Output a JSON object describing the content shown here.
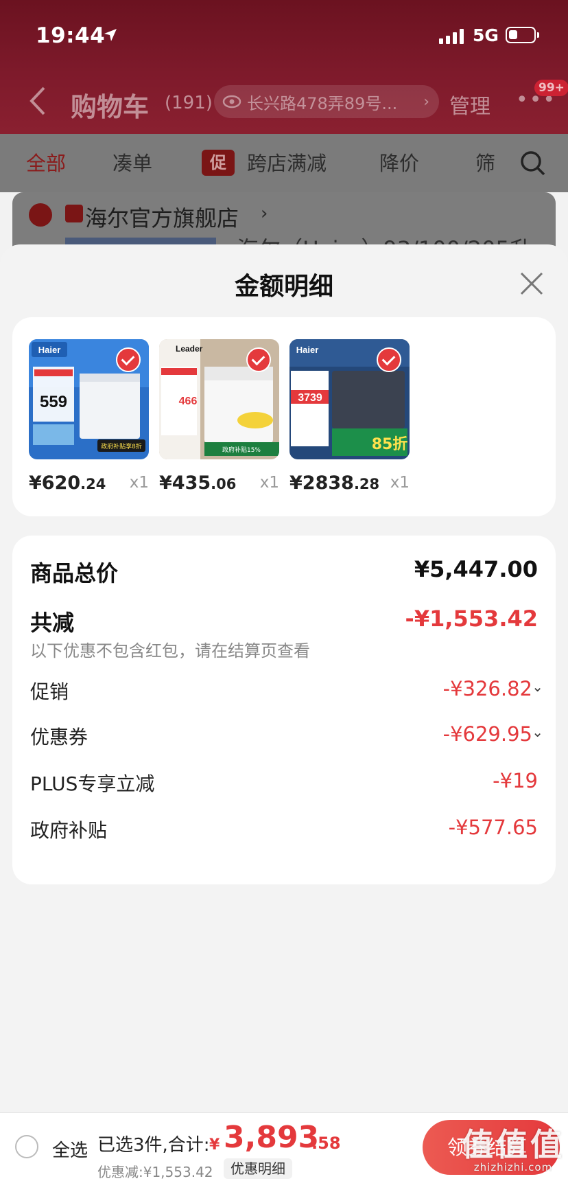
{
  "status_bar": {
    "time": "19:44",
    "network": "5G"
  },
  "nav": {
    "title": "购物车",
    "count": "(191)",
    "address": "长兴路478弄89号...",
    "manage_label": "管理",
    "badge": "99+"
  },
  "tabs": [
    {
      "label": "全部",
      "active": true
    },
    {
      "label": "凑单"
    },
    {
      "label": "跨店满减",
      "tag": "促"
    },
    {
      "label": "降价"
    },
    {
      "label": "筛"
    }
  ],
  "store": {
    "name": "海尔官方旗舰店",
    "product_title_peek": "海尔（Haier）93/100/205升"
  },
  "sheet": {
    "title": "金额明细",
    "items": [
      {
        "brand": "Haier",
        "price_int": "¥620",
        "price_dec": ".24",
        "qty": "x1",
        "promo_big": "559",
        "badge_text": "政府补贴享8折"
      },
      {
        "brand": "Leader",
        "price_int": "¥435",
        "price_dec": ".06",
        "qty": "x1",
        "promo_big": "466",
        "badge_text": "政府补贴15%"
      },
      {
        "brand": "Haier",
        "price_int": "¥2838",
        "price_dec": ".28",
        "qty": "x1",
        "promo_big": "3739",
        "badge_text": "85折"
      }
    ],
    "summary": {
      "total_label": "商品总价",
      "total_value": "¥5,447.00",
      "reduce_label": "共减",
      "reduce_value": "-¥1,553.42",
      "note": "以下优惠不包含红包，请在结算页查看",
      "lines": [
        {
          "label": "促销",
          "value": "-¥326.82",
          "expandable": true
        },
        {
          "label": "优惠券",
          "value": "-¥629.95",
          "expandable": true
        },
        {
          "label": "PLUS专享立减",
          "value": "-¥19",
          "expandable": false
        },
        {
          "label": "政府补贴",
          "value": "-¥577.65",
          "expandable": false
        }
      ]
    }
  },
  "bottom_bar": {
    "select_all": "全选",
    "selected_text": "已选3件,合计:",
    "total_symbol": "¥",
    "total_int": "3,893",
    "total_dec": ".58",
    "discount_text": "优惠减:¥1,553.42",
    "detail_label": "优惠明细",
    "checkout_label": "领券结算"
  },
  "watermark": {
    "big": "值值值",
    "small": "zhizhizhi.com"
  },
  "colors": {
    "accent": "#e4393c",
    "header_bg": "#7e1a2b"
  }
}
